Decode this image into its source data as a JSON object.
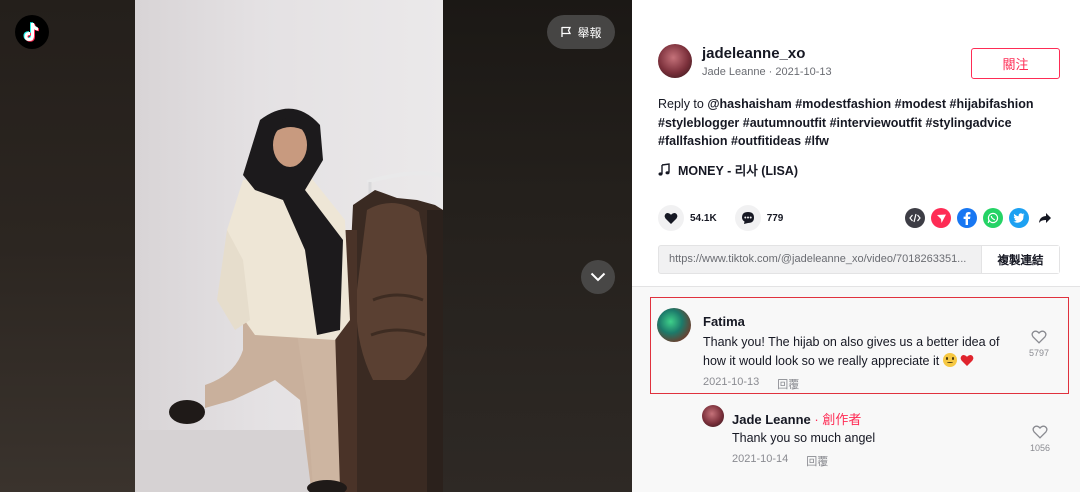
{
  "video": {
    "report_label": "舉報"
  },
  "author": {
    "handle": "jadeleanne_xo",
    "name_date": "Jade Leanne · 2021-10-13",
    "follow_label": "關注"
  },
  "caption": {
    "prefix": "Reply to ",
    "mention": "@hashaisham",
    "tags": [
      "#modestfashion",
      "#modest",
      "#hijabifashion",
      "#styleblogger",
      "#autumnoutfit",
      "#interviewoutfit",
      "#stylingadvice",
      "#fallfashion",
      "#outfitideas",
      "#lfw"
    ]
  },
  "music": {
    "title": "MONEY - 리사 (LISA)"
  },
  "stats": {
    "likes": "54.1K",
    "comments": "779"
  },
  "share_icons": [
    "embed-icon",
    "send-icon",
    "facebook-icon",
    "whatsapp-icon",
    "twitter-icon",
    "share-arrow-icon"
  ],
  "colors": {
    "accent": "#fe2c55",
    "highlight_border": "#e0323e",
    "facebook": "#1877f2",
    "whatsapp": "#25d366",
    "twitter": "#1da1f2",
    "send": "#fe2c55",
    "embed": "#3d3d45"
  },
  "link": {
    "url": "https://www.tiktok.com/@jadeleanne_xo/video/7018263351...",
    "copy_label": "複製連結"
  },
  "comments": [
    {
      "user": "Fatima",
      "text": "Thank you! The hijab on also gives us a better idea of how it would look so we really appreciate it",
      "date": "2021-10-13",
      "reply_label": "回覆",
      "likes": "5797"
    },
    {
      "user": "Jade Leanne",
      "badge": " · 創作者",
      "text": "Thank you so much angel",
      "date": "2021-10-14",
      "reply_label": "回覆",
      "likes": "1056"
    }
  ]
}
